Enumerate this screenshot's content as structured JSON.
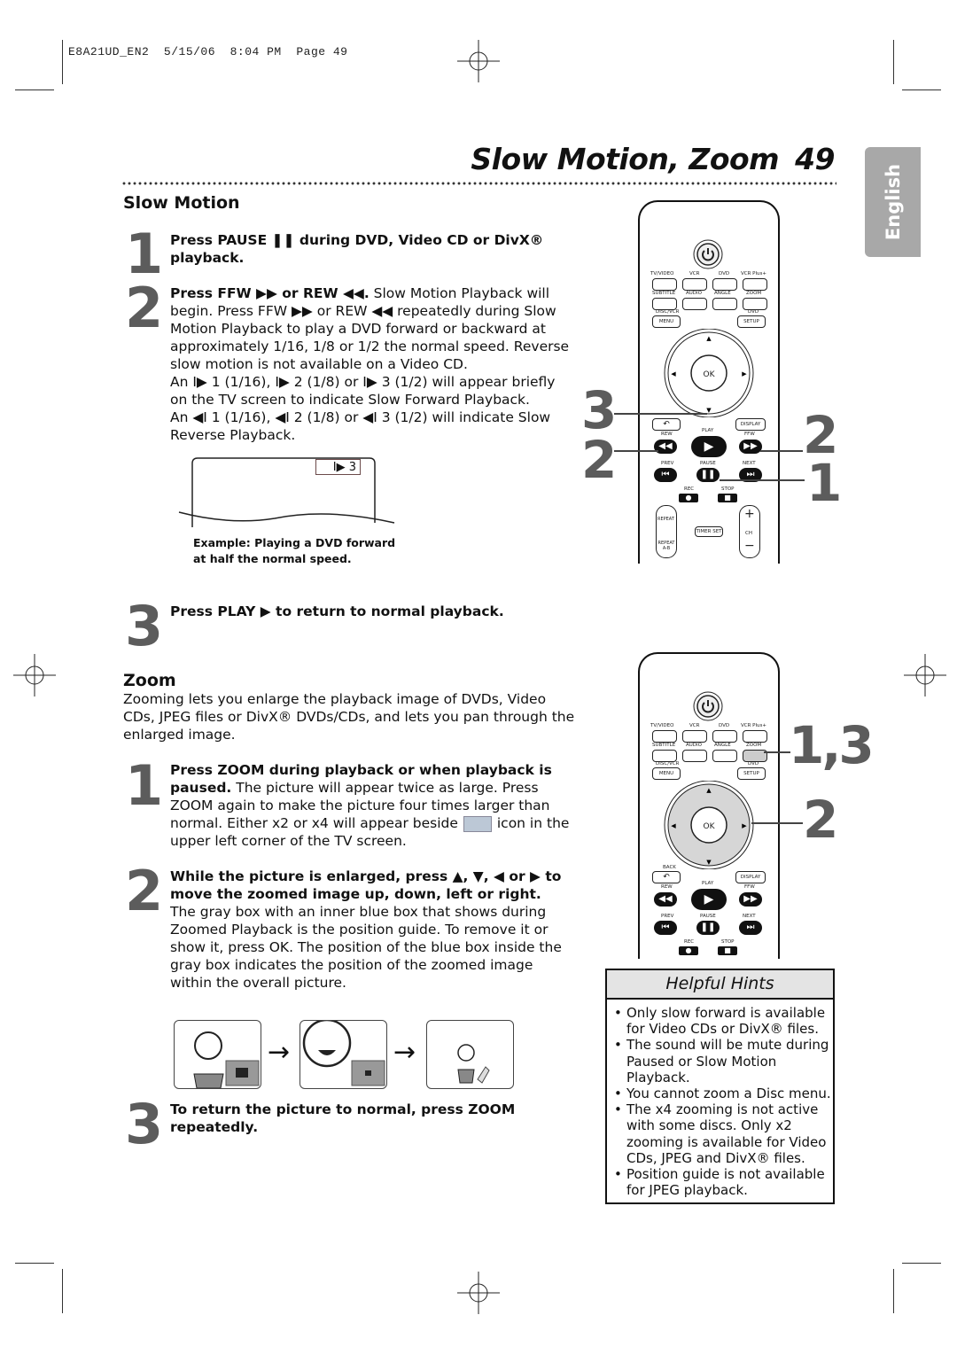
{
  "print_stamp": "E8A21UD_EN2  5/15/06  8:04 PM  Page 49",
  "header": {
    "title": "Slow Motion, Zoom",
    "page_number": "49",
    "language_tab": "English"
  },
  "slow_motion": {
    "heading": "Slow Motion",
    "steps": [
      {
        "number": "1",
        "bold": "Press PAUSE ❚❚ during DVD, Video CD or DivX® playback.",
        "text": ""
      },
      {
        "number": "2",
        "bold": "Press FFW ▶▶ or REW ◀◀.",
        "text": " Slow Motion Playback will begin. Press FFW ▶▶ or REW ◀◀ repeatedly during Slow Motion Playback to play a DVD forward or backward at approximately 1/16, 1/8 or 1/2 the normal speed. Reverse slow motion is not available on a Video CD.",
        "text2": "An I▶ 1 (1/16), I▶ 2 (1/8) or I▶ 3 (1/2) will appear briefly on the TV screen to indicate Slow Forward Playback.",
        "text3": "An ◀I 1 (1/16), ◀I 2 (1/8) or ◀I 3 (1/2) will indicate Slow Reverse Playback."
      },
      {
        "number": "3",
        "bold": "Press PLAY ▶ to return to normal playback.",
        "text": ""
      }
    ],
    "osd_indicator": "I▶   3",
    "caption_line1": "Example: Playing a DVD forward",
    "caption_line2": "at half the normal speed."
  },
  "zoom": {
    "heading": "Zoom",
    "intro": "Zooming lets you enlarge the playback image of DVDs, Video CDs, JPEG files or DivX® DVDs/CDs, and lets you pan through the enlarged image.",
    "steps": [
      {
        "number": "1",
        "bold": "Press ZOOM during playback or when playback is paused.",
        "text": " The picture will appear twice as large. Press ZOOM again to make the picture four times larger than normal. Either x2 or x4 will appear beside",
        "text_after": "icon in the upper left corner of the TV screen."
      },
      {
        "number": "2",
        "bold": "While the picture is enlarged, press ▲, ▼, ◀ or ▶ to move the zoomed image up, down, left or right.",
        "text": "The gray box with an inner blue box that shows during Zoomed Playback is the position guide. To remove it or show it, press OK. The position of the blue box inside the gray box indicates the position of the zoomed image within the overall picture."
      },
      {
        "number": "3",
        "bold": "To return the picture to normal, press ZOOM repeatedly.",
        "text": ""
      }
    ],
    "arrow_glyph": "→"
  },
  "remote": {
    "row1": [
      "TV/VIDEO",
      "VCR",
      "DVD",
      "VCR Plus+"
    ],
    "row2": [
      "SUBTITLE",
      "AUDIO",
      "ANGLE",
      "ZOOM"
    ],
    "menu_top": "DISC/VCR",
    "menu": "MENU",
    "setup_top": "DVD",
    "setup": "SETUP",
    "ok": "OK",
    "back": "BACK",
    "display": "DISPLAY",
    "play": "PLAY",
    "rew": "REW",
    "ffw": "FFW",
    "prev": "PREV",
    "pause": "PAUSE",
    "next": "NEXT",
    "rec": "REC",
    "stop": "STOP",
    "repeat": "REPEAT",
    "repeat_ab": "REPEAT A-B",
    "timer_set": "TIMER SET",
    "ch": "CH"
  },
  "callouts_slow": {
    "left_top": "3",
    "left_bottom": "2",
    "right_top": "2",
    "right_bottom": "1"
  },
  "callouts_zoom": {
    "right_top": "1,3",
    "right_bottom": "2"
  },
  "hints": {
    "title": "Helpful Hints",
    "items": [
      "Only slow forward is available for Video CDs or DivX® files.",
      "The sound will be mute during Paused or Slow Motion Playback.",
      "You cannot zoom a Disc menu.",
      "The x4 zooming is not active with some discs. Only x2 zooming is available for Video CDs, JPEG and DivX® files.",
      "Position guide is not available for JPEG playback."
    ]
  }
}
